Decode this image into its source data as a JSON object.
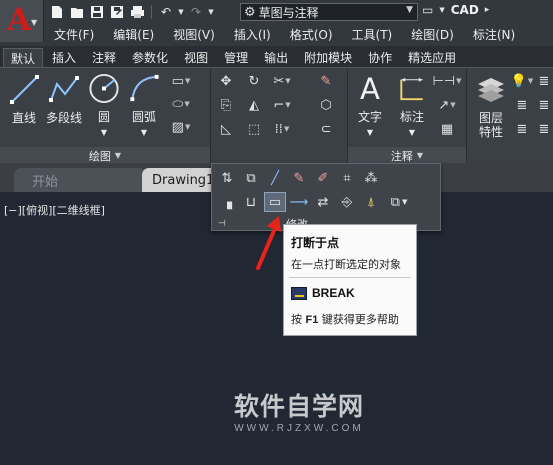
{
  "app": {
    "logo_letter": "A",
    "workspace": "草图与注释",
    "title_right_badge": "CAD"
  },
  "quick_access": {
    "icons": [
      "new-icon",
      "open-icon",
      "save-icon",
      "save-as-icon",
      "print-icon",
      "undo-icon",
      "redo-icon"
    ]
  },
  "menu": {
    "items": [
      "文件(F)",
      "编辑(E)",
      "视图(V)",
      "插入(I)",
      "格式(O)",
      "工具(T)",
      "绘图(D)",
      "标注(N)"
    ]
  },
  "ribbon_tabs": [
    "默认",
    "插入",
    "注释",
    "参数化",
    "视图",
    "管理",
    "输出",
    "附加模块",
    "协作",
    "精选应用"
  ],
  "active_tab": "默认",
  "panels": {
    "draw": {
      "title": "绘图",
      "tools": [
        "直线",
        "多段线",
        "圆",
        "圆弧"
      ]
    },
    "annotation": {
      "title": "注释",
      "tools": [
        "文字",
        "标注"
      ]
    },
    "layers": {
      "tool": "图层",
      "tool2": "特性"
    }
  },
  "doc_tabs": {
    "start": "开始",
    "drawing": "Drawing1"
  },
  "viewport_label": "[−][俯视][二维线框]",
  "modify_panel": {
    "title": "修改"
  },
  "tooltip": {
    "title": "打断于点",
    "description": "在一点打断选定的对象",
    "command": "BREAK",
    "help_prefix": "按",
    "help_key": "F1",
    "help_suffix": "键获得更多帮助"
  },
  "watermark": {
    "main": "软件自学网",
    "sub": "WWW.RJZXW.COM"
  },
  "colors": {
    "logo_red": "#d21a1a",
    "canvas": "#212733",
    "ribbon": "#3b4047",
    "annotation_arrow": "#e8231c"
  }
}
